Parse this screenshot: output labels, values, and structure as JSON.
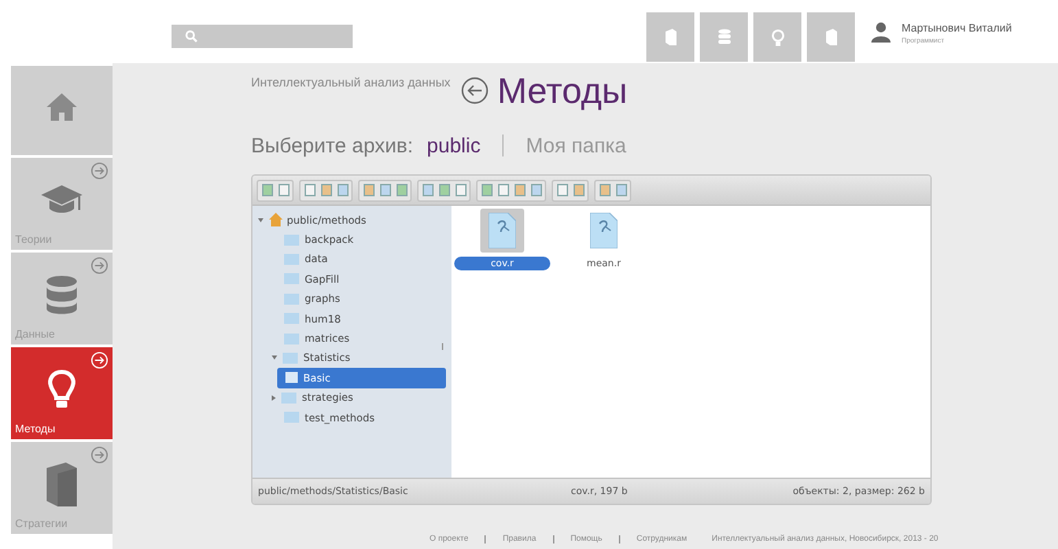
{
  "header": {
    "user": {
      "name": "Мартынович Виталий",
      "role": "Программист"
    }
  },
  "sidebar": {
    "items": [
      {
        "selected": false,
        "arrow": false
      },
      {
        "label": "Теории",
        "selected": false,
        "arrow": true
      },
      {
        "label": "Данные",
        "selected": false,
        "arrow": true
      },
      {
        "label": "Методы",
        "selected": true,
        "arrow": true
      },
      {
        "label": "Стратегии",
        "selected": false,
        "arrow": true
      }
    ]
  },
  "page": {
    "breadcrumb": "Интеллектуальный анализ данных",
    "title": "Методы"
  },
  "archive": {
    "label": "Выберите архив:",
    "options": [
      {
        "label": "public",
        "selected": true
      },
      {
        "label": "Моя папка",
        "selected": false
      }
    ]
  },
  "file_manager": {
    "tree": [
      {
        "name": "public/methods",
        "expanded": true,
        "selected": false,
        "children": [
          {
            "name": "backpack",
            "selected": false
          },
          {
            "name": "data",
            "selected": false
          },
          {
            "name": "GapFill",
            "selected": false
          },
          {
            "name": "graphs",
            "selected": false
          },
          {
            "name": "hum18",
            "selected": false
          },
          {
            "name": "matrices",
            "selected": false
          },
          {
            "name": "Statistics",
            "expanded": true,
            "selected": false,
            "children": [
              {
                "name": "Basic",
                "selected": true
              }
            ]
          },
          {
            "name": "strategies",
            "expanded": false,
            "selected": false
          },
          {
            "name": "test_methods",
            "selected": false
          }
        ]
      }
    ],
    "files": [
      {
        "name": "cov.r",
        "selected": true
      },
      {
        "name": "mean.r",
        "selected": false
      }
    ],
    "status_bar": {
      "path": "public/methods/Statistics/Basic",
      "selection": "cov.r, 197 b",
      "summary": "объекты: 2, размер: 262 b"
    }
  },
  "footer": {
    "links": [
      "О проекте",
      "Правила",
      "Помощь",
      "Сотрудникам"
    ],
    "copyright": "Интеллектуальный анализ данных, Новосибирск, 2013 - 20"
  }
}
